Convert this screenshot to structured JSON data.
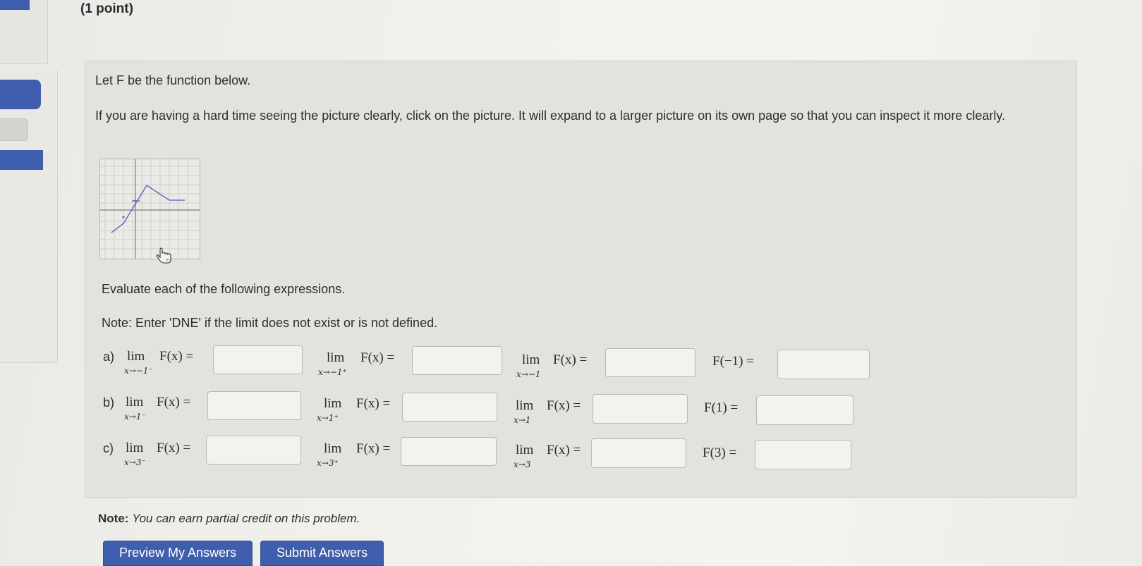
{
  "header": {
    "points": "(1 point)"
  },
  "problem": {
    "intro": "Let F be the function below.",
    "expand_note": "If you are having a hard time seeing the picture clearly, click on the picture. It will expand to a larger picture on its own page so that you can inspect it more clearly.",
    "evaluate": "Evaluate each of the following expressions.",
    "dne_note": "Note: Enter 'DNE' if the limit does not exist or is not defined."
  },
  "graph": {
    "icon": "hand-pointer-cursor-icon"
  },
  "rows": [
    {
      "label": "a)",
      "limits": [
        {
          "lim": "lim",
          "sub": "x→−1⁻",
          "expr": "F(x) ="
        },
        {
          "lim": "lim",
          "sub": "x→−1⁺",
          "expr": "F(x) ="
        },
        {
          "lim": "lim",
          "sub": "x→−1",
          "expr": "F(x) ="
        }
      ],
      "value_expr": "F(−1) =",
      "answers": [
        "",
        "",
        "",
        ""
      ]
    },
    {
      "label": "b)",
      "limits": [
        {
          "lim": "lim",
          "sub": "x→1⁻",
          "expr": "F(x) ="
        },
        {
          "lim": "lim",
          "sub": "x→1⁺",
          "expr": "F(x) ="
        },
        {
          "lim": "lim",
          "sub": "x→1",
          "expr": "F(x) ="
        }
      ],
      "value_expr": "F(1) =",
      "answers": [
        "",
        "",
        "",
        ""
      ]
    },
    {
      "label": "c)",
      "limits": [
        {
          "lim": "lim",
          "sub": "x→3⁻",
          "expr": "F(x) ="
        },
        {
          "lim": "lim",
          "sub": "x→3⁺",
          "expr": "F(x) ="
        },
        {
          "lim": "lim",
          "sub": "x→3",
          "expr": "F(x) ="
        }
      ],
      "value_expr": "F(3) =",
      "answers": [
        "",
        "",
        "",
        ""
      ]
    }
  ],
  "footer": {
    "note_bold": "Note:",
    "note_italic": "You can earn partial credit on this problem."
  },
  "buttons": {
    "preview": "Preview My Answers",
    "submit": "Submit Answers"
  },
  "colors": {
    "accent": "#3f5fae",
    "graph_line": "#6a6fc0"
  }
}
